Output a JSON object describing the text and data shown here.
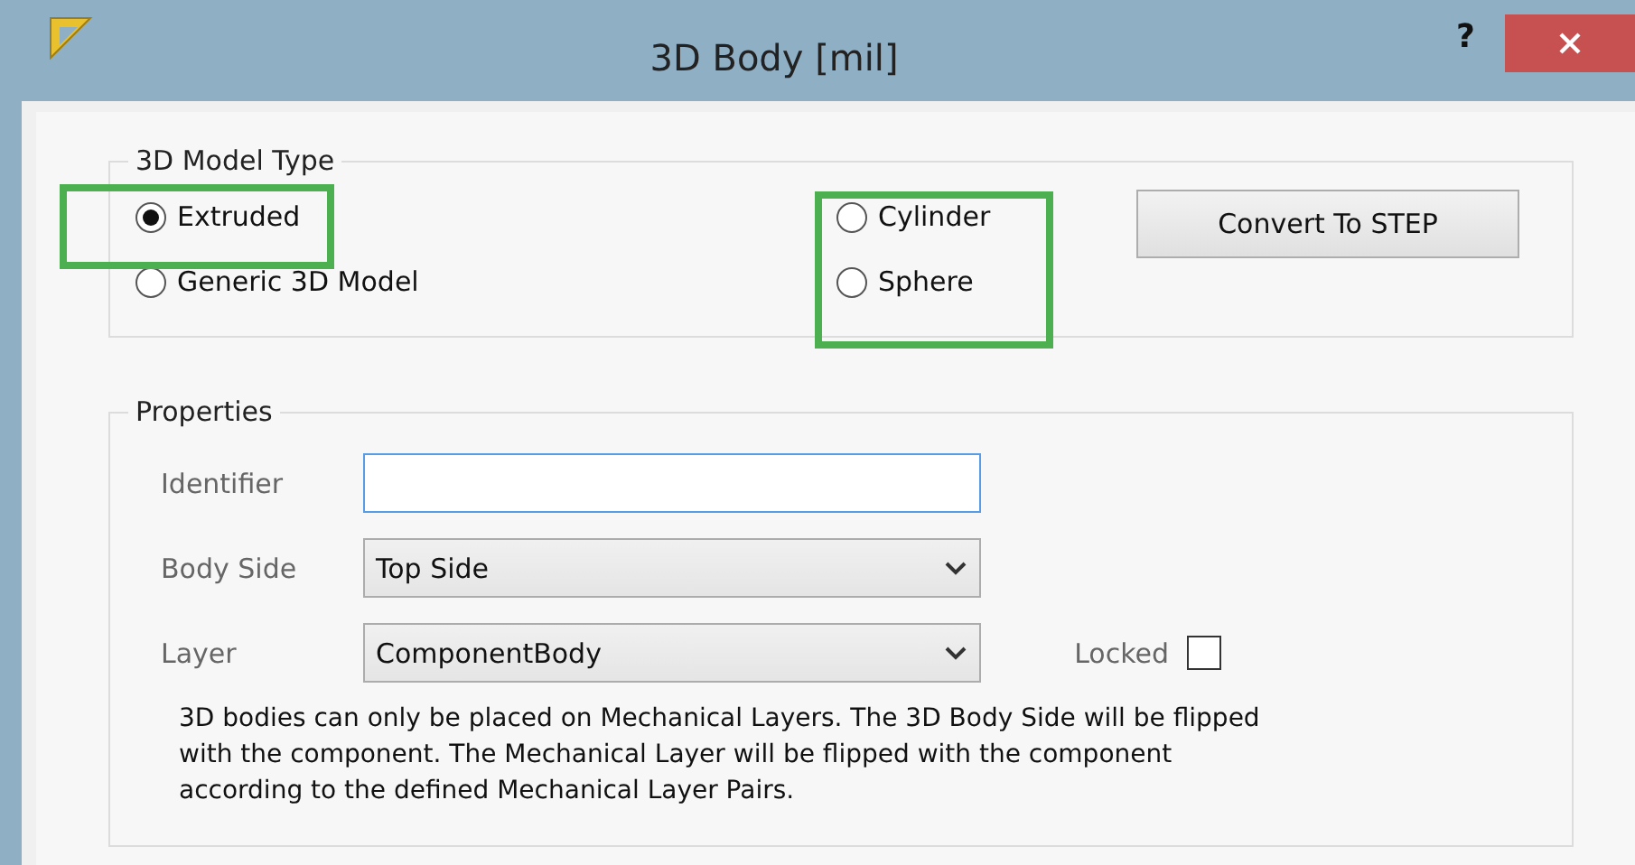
{
  "window": {
    "title": "3D Body [mil]",
    "help": "?"
  },
  "model_type": {
    "title": "3D Model Type",
    "options": [
      {
        "label": "Extruded",
        "selected": true
      },
      {
        "label": "Generic 3D Model",
        "selected": false
      },
      {
        "label": "Cylinder",
        "selected": false
      },
      {
        "label": "Sphere",
        "selected": false
      }
    ],
    "button": "Convert To STEP"
  },
  "properties": {
    "title": "Properties",
    "identifier": {
      "label": "Identifier"
    },
    "body_side": {
      "label": "Body Side",
      "value": "Top Side"
    },
    "layer": {
      "label": "Layer",
      "value": "ComponentBody"
    },
    "locked": {
      "label": "Locked",
      "checked": false
    },
    "note": "3D bodies can only be placed on Mechanical Layers. The 3D Body Side will be flipped with the component. The Mechanical Layer will be flipped with the component according to the defined Mechanical Layer Pairs."
  }
}
